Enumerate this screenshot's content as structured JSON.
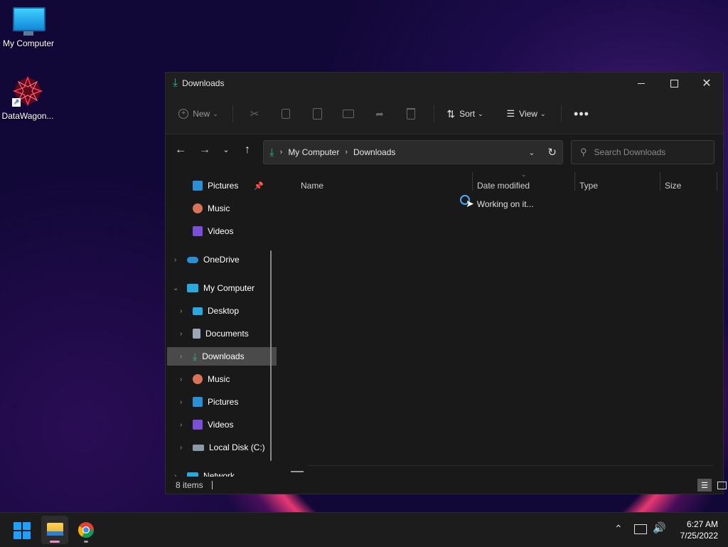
{
  "desktop": {
    "icons": [
      {
        "label": "My Computer"
      },
      {
        "label": "DataWagon..."
      }
    ]
  },
  "window": {
    "title": "Downloads",
    "toolbar": {
      "new_label": "New",
      "sort_label": "Sort",
      "view_label": "View"
    },
    "address": {
      "crumbs": [
        "My Computer",
        "Downloads"
      ]
    },
    "search": {
      "placeholder": "Search Downloads"
    },
    "nav": {
      "items": [
        {
          "label": "Pictures"
        },
        {
          "label": "Music"
        },
        {
          "label": "Videos"
        },
        {
          "label": "OneDrive"
        },
        {
          "label": "My Computer"
        },
        {
          "label": "Desktop"
        },
        {
          "label": "Documents"
        },
        {
          "label": "Downloads"
        },
        {
          "label": "Music"
        },
        {
          "label": "Pictures"
        },
        {
          "label": "Videos"
        },
        {
          "label": "Local Disk (C:)"
        },
        {
          "label": "Network"
        }
      ]
    },
    "columns": [
      "Name",
      "Date modified",
      "Type",
      "Size"
    ],
    "loading_text": "Working on it...",
    "status": {
      "items": "8 items"
    }
  },
  "taskbar": {
    "time": "6:27 AM",
    "date": "7/25/2022"
  },
  "colors": {
    "accent_green": "#2eb67d",
    "selected_nav": "#4a4a4a",
    "window_bg": "#191919"
  }
}
